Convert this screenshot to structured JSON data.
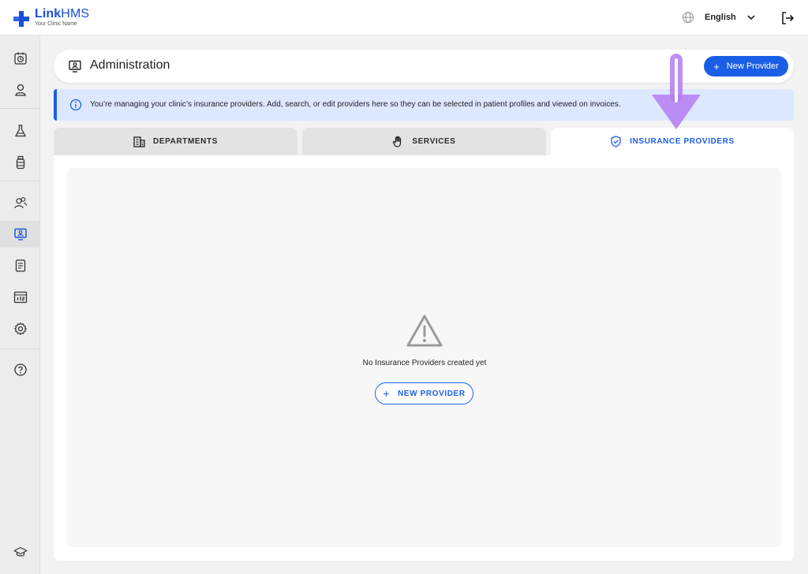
{
  "brand": {
    "name_bold": "Link",
    "name_light": "HMS",
    "subtitle": "Your Clinic Name",
    "color": "#1a4fd6"
  },
  "topbar": {
    "language": "English",
    "icons": [
      "globe-icon",
      "chevron-down-icon",
      "logout-icon"
    ]
  },
  "sidebar": {
    "items": [
      {
        "name": "appointments",
        "icon": "calendar-clock-icon"
      },
      {
        "name": "patients",
        "icon": "user-icon"
      },
      {
        "name": "lab",
        "icon": "flask-icon"
      },
      {
        "name": "pharmacy",
        "icon": "medicine-bottle-icon"
      },
      {
        "name": "staff",
        "icon": "users-icon"
      },
      {
        "name": "administration",
        "icon": "monitor-user-icon",
        "active": true
      },
      {
        "name": "billing",
        "icon": "receipt-icon"
      },
      {
        "name": "reports",
        "icon": "chart-icon"
      },
      {
        "name": "settings",
        "icon": "gear-icon"
      },
      {
        "name": "help",
        "icon": "help-circle-icon"
      },
      {
        "name": "training",
        "icon": "graduation-cap-icon"
      }
    ]
  },
  "header": {
    "title": "Administration",
    "new_button": "New Provider"
  },
  "info": {
    "text": "You’re managing your clinic’s insurance providers. Add, search, or edit providers here so they can be selected in patient profiles and viewed on invoices."
  },
  "tabs": [
    {
      "label": "DEPARTMENTS",
      "icon": "building-icon",
      "active": false
    },
    {
      "label": "SERVICES",
      "icon": "hand-icon",
      "active": false
    },
    {
      "label": "INSURANCE PROVIDERS",
      "icon": "shield-check-icon",
      "active": true
    }
  ],
  "empty_state": {
    "message": "No Insurance Providers created yet",
    "button": "NEW PROVIDER",
    "icon": "warning-triangle-icon"
  },
  "colors": {
    "accent": "#1a5ee6",
    "info_bg": "#dce8ff",
    "annotation_arrow": "#b57bf2"
  }
}
